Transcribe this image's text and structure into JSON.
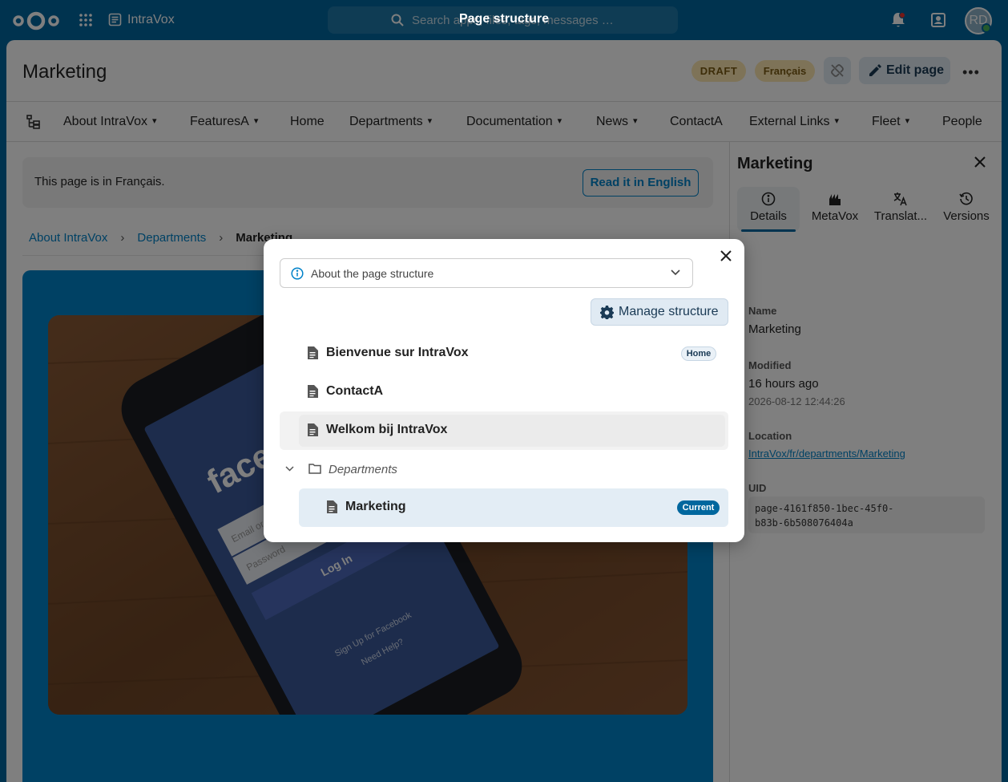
{
  "topbar": {
    "app_name": "IntraVox",
    "search_placeholder": "Search apps, files, tags, messages …",
    "overlay_title": "Page structure",
    "avatar_initials": "RD"
  },
  "header": {
    "title": "Marketing",
    "badge_draft": "DRAFT",
    "badge_lang": "Français",
    "edit_label": "Edit page",
    "more_label": "•••"
  },
  "nav": {
    "items": [
      {
        "label": "About IntraVox",
        "chevron": true
      },
      {
        "label": "FeaturesA",
        "chevron": true
      },
      {
        "label": "Home",
        "chevron": false
      },
      {
        "label": "Departments",
        "chevron": true
      },
      {
        "label": "Documentation",
        "chevron": true
      },
      {
        "label": "News",
        "chevron": true
      },
      {
        "label": "ContactA",
        "chevron": false
      },
      {
        "label": "External Links",
        "chevron": true
      },
      {
        "label": "Fleet",
        "chevron": true
      },
      {
        "label": "People",
        "chevron": false
      }
    ]
  },
  "language_notice": {
    "text": "This page is in Français.",
    "button": "Read it in English"
  },
  "breadcrumb": {
    "items": [
      "About IntraVox",
      "Departments"
    ],
    "current": "Marketing",
    "separator": "›"
  },
  "sidebar": {
    "title": "Marketing",
    "tabs": [
      {
        "label": "Details",
        "icon": "info-icon"
      },
      {
        "label": "MetaVox",
        "icon": "metavox-icon"
      },
      {
        "label": "Translat...",
        "icon": "translate-icon"
      },
      {
        "label": "Versions",
        "icon": "history-icon"
      }
    ],
    "name_label": "Name",
    "name_value": "Marketing",
    "modified_label": "Modified",
    "modified_value": "16 hours ago",
    "modified_date": "2026-08-12 12:44:26",
    "location_label": "Location",
    "location_value": "IntraVox/fr/departments/Marketing",
    "uid_label": "UID",
    "uid_line1": "page-4161f850-1bec-45f0-",
    "uid_line2": "b83b-6b508076404a"
  },
  "modal": {
    "about_label": "About the page structure",
    "manage_label": "Manage structure",
    "pages": [
      {
        "label": "Bienvenue sur IntraVox",
        "badge": "Home"
      },
      {
        "label": "ContactA"
      },
      {
        "label": "Welkom bij IntraVox"
      }
    ],
    "folder_label": "Departments",
    "child_page": {
      "label": "Marketing",
      "badge": "Current"
    }
  },
  "hero_image": {
    "brand_text": "facebook",
    "field_email": "Email or phone number",
    "field_password": "Password",
    "login_text": "Log In",
    "signup_text": "Sign Up for Facebook",
    "help_text": "Need Help?"
  },
  "colors": {
    "brand": "#00679e",
    "accent": "#0082c9",
    "badge_bg": "#fde7b0"
  }
}
